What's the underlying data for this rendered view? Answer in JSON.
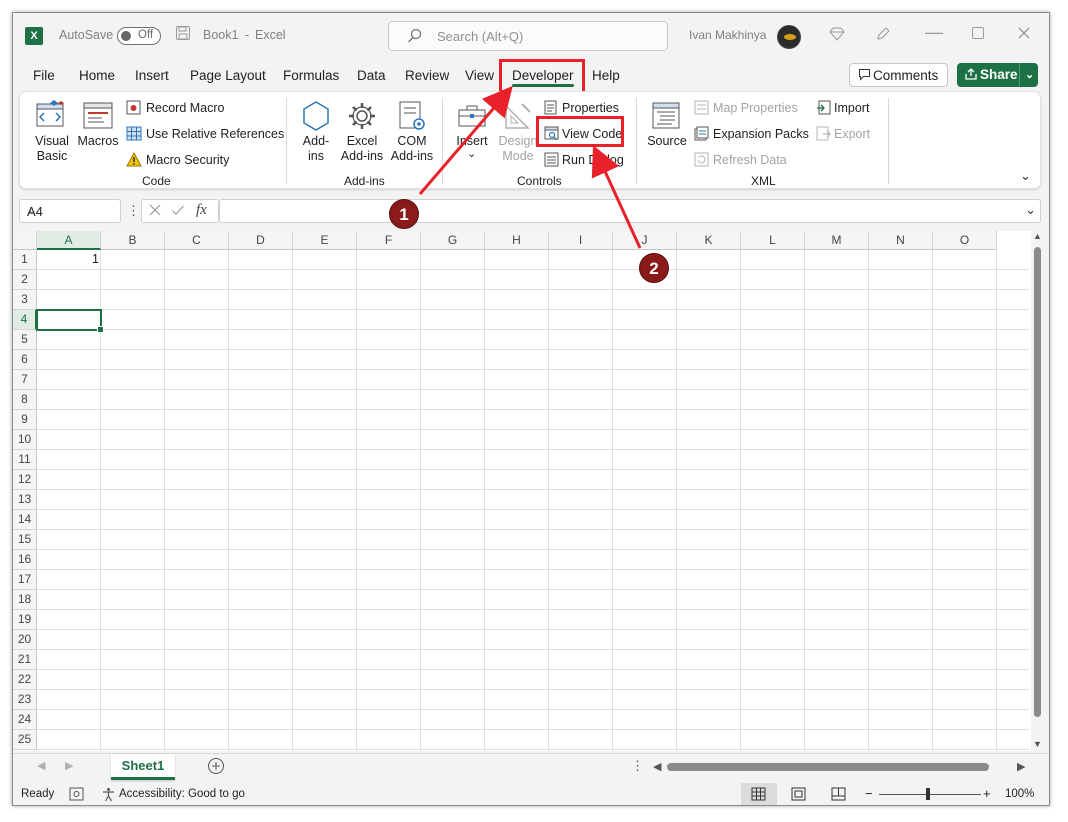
{
  "titlebar": {
    "app_icon_letter": "X",
    "autosave_label": "AutoSave",
    "autosave_state": "Off",
    "document": "Book1",
    "separator": "-",
    "app_name": "Excel",
    "search_placeholder": "Search (Alt+Q)",
    "user_name": "Ivan Makhinya"
  },
  "tabs": [
    "File",
    "Home",
    "Insert",
    "Page Layout",
    "Formulas",
    "Data",
    "Review",
    "View",
    "Developer",
    "Help"
  ],
  "active_tab": "Developer",
  "actions": {
    "comments": "Comments",
    "share": "Share"
  },
  "ribbon": {
    "code": {
      "label": "Code",
      "visual_basic": [
        "Visual",
        "Basic"
      ],
      "macros": "Macros",
      "record_macro": "Record Macro",
      "relative_refs": "Use Relative References",
      "macro_security": "Macro Security"
    },
    "addins": {
      "label": "Add-ins",
      "addins": [
        "Add-",
        "ins"
      ],
      "excel_addins": [
        "Excel",
        "Add-ins"
      ],
      "com_addins": [
        "COM",
        "Add-ins"
      ]
    },
    "controls": {
      "label": "Controls",
      "insert": "Insert",
      "design_mode": [
        "Design",
        "Mode"
      ],
      "properties": "Properties",
      "view_code": "View Code",
      "run_dialog": "Run Dialog"
    },
    "xml": {
      "label": "XML",
      "source": "Source",
      "map_properties": "Map Properties",
      "expansion_packs": "Expansion Packs",
      "refresh_data": "Refresh Data",
      "import": "Import",
      "export": "Export"
    }
  },
  "formula_bar": {
    "name_box": "A4",
    "fx": "fx",
    "value": ""
  },
  "grid": {
    "columns": [
      "A",
      "B",
      "C",
      "D",
      "E",
      "F",
      "G",
      "H",
      "I",
      "J",
      "K",
      "L",
      "M",
      "N",
      "O"
    ],
    "rows": [
      "1",
      "2",
      "3",
      "4",
      "5",
      "6",
      "7",
      "8",
      "9",
      "10",
      "11",
      "12",
      "13",
      "14",
      "15",
      "16",
      "17",
      "18",
      "19",
      "20",
      "21",
      "22",
      "23",
      "24",
      "25"
    ],
    "cell_A1": "1",
    "active_cell": "A4"
  },
  "sheets": [
    "Sheet1"
  ],
  "status": {
    "ready": "Ready",
    "accessibility": "Accessibility: Good to go",
    "zoom": "100%"
  },
  "annotations": {
    "step1": "1",
    "step2": "2",
    "color": "#e8212b"
  },
  "colors": {
    "excel_green": "#1e7145",
    "badge": "#8b1a1a"
  }
}
